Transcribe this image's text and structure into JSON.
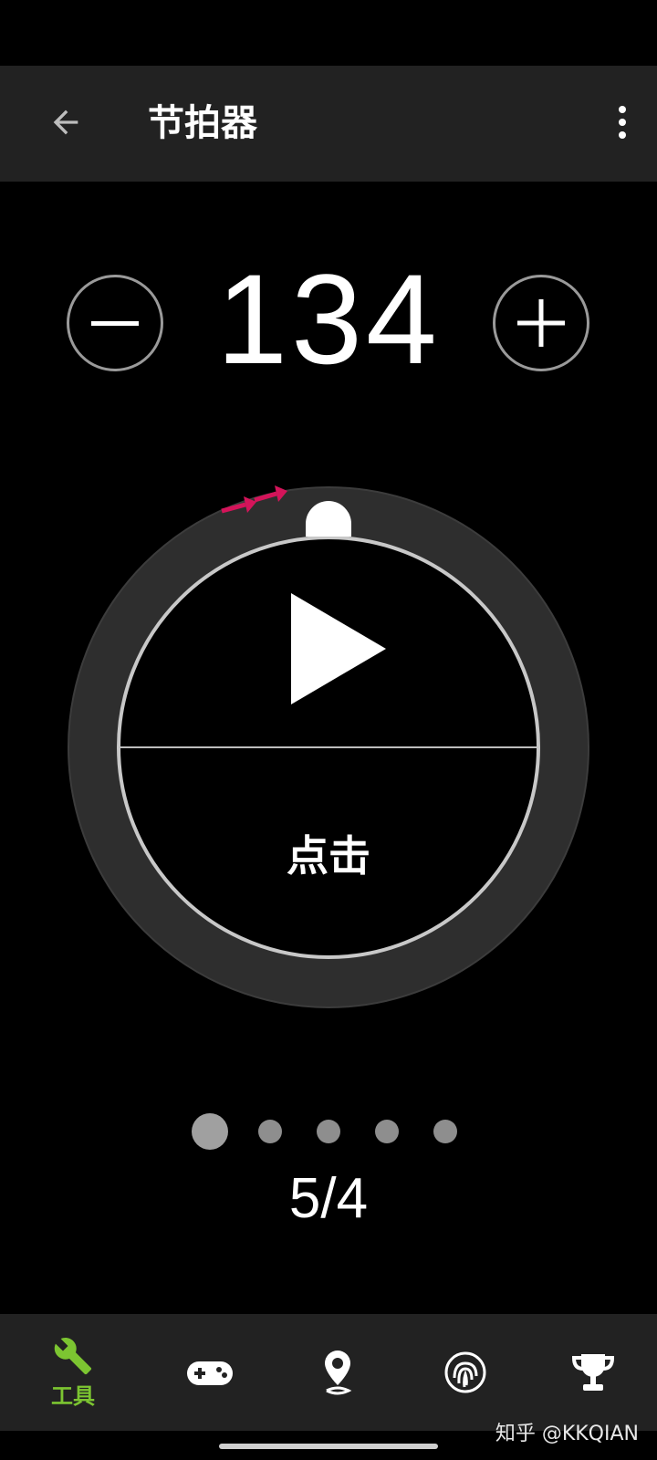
{
  "app_bar": {
    "title": "节拍器",
    "back_icon": "arrow-left-icon",
    "menu_icon": "more-vertical-icon"
  },
  "tempo": {
    "value": "134",
    "decrease_icon": "minus-icon",
    "increase_icon": "plus-icon"
  },
  "dial": {
    "play_icon": "play-icon",
    "tap_label": "点击"
  },
  "beat_pager": {
    "count": 5,
    "active_index": 0
  },
  "time_signature": "5/4",
  "bottom_nav": {
    "items": [
      {
        "label": "工具",
        "icon": "wrench-icon",
        "active": true
      },
      {
        "label": "",
        "icon": "gamepad-icon",
        "active": false
      },
      {
        "label": "",
        "icon": "location-pin-icon",
        "active": false
      },
      {
        "label": "",
        "icon": "fingerprint-icon",
        "active": false
      },
      {
        "label": "",
        "icon": "trophy-icon",
        "active": false
      }
    ]
  },
  "watermark": "知乎 @KKQIAN",
  "colors": {
    "accent_green": "#7cc531",
    "annotation_magenta": "#d4145a",
    "bar_background": "#222222"
  }
}
